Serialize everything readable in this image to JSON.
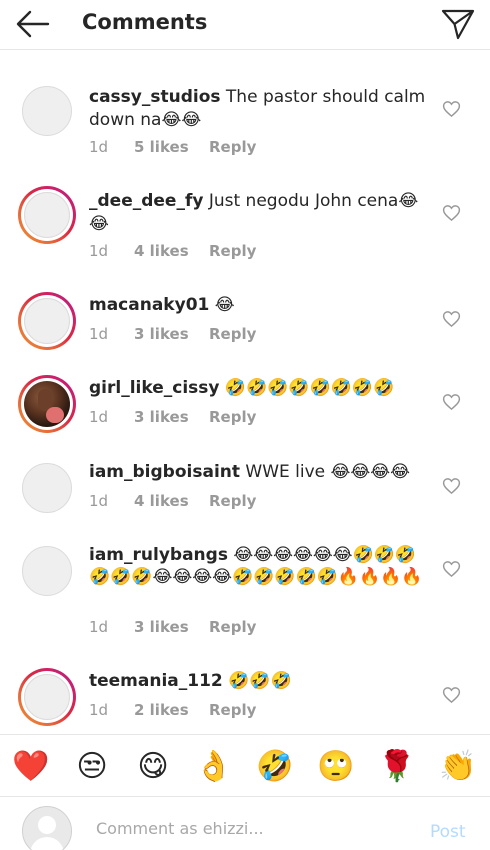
{
  "header": {
    "title": "Comments",
    "back_icon": "back-arrow-icon",
    "send_icon": "paper-plane-icon"
  },
  "comments": [
    {
      "user": "cassy_studios",
      "text": "The pastor should calm down na😂😂",
      "time": "1d",
      "likes": "5 likes",
      "reply": "Reply",
      "ring": false
    },
    {
      "user": "_dee_dee_fy",
      "text": "Just negodu John cena😂😂",
      "time": "1d",
      "likes": "4 likes",
      "reply": "Reply",
      "ring": true
    },
    {
      "user": "macanaky01",
      "text": "😂",
      "time": "1d",
      "likes": "3 likes",
      "reply": "Reply",
      "ring": true
    },
    {
      "user": "girl_like_cissy",
      "text": "🤣🤣🤣🤣🤣🤣🤣🤣",
      "time": "1d",
      "likes": "3 likes",
      "reply": "Reply",
      "ring": true,
      "photo": true
    },
    {
      "user": "iam_bigboisaint",
      "text": "WWE live 😂😂😂😂",
      "time": "1d",
      "likes": "4 likes",
      "reply": "Reply",
      "ring": false
    },
    {
      "user": "iam_rulybangs",
      "text": "😂😂😂😂😂😂🤣🤣🤣🤣🤣🤣😂😂😂😂🤣🤣🤣🤣🤣🔥🔥🔥🔥",
      "time": "1d",
      "likes": "3 likes",
      "reply": "Reply",
      "ring": false
    },
    {
      "user": "teemania_112",
      "text": "🤣🤣🤣",
      "time": "1d",
      "likes": "2 likes",
      "reply": "Reply",
      "ring": true
    }
  ],
  "emoji_bar": [
    "❤️",
    "😒",
    "😋",
    "👌",
    "🤣",
    "🙄",
    "🌹",
    "👏"
  ],
  "input": {
    "placeholder": "Comment as ehizzi...",
    "post_label": "Post"
  },
  "colors": {
    "link_disabled": "#b3dbff",
    "meta_gray": "#999999",
    "text": "#262626"
  }
}
